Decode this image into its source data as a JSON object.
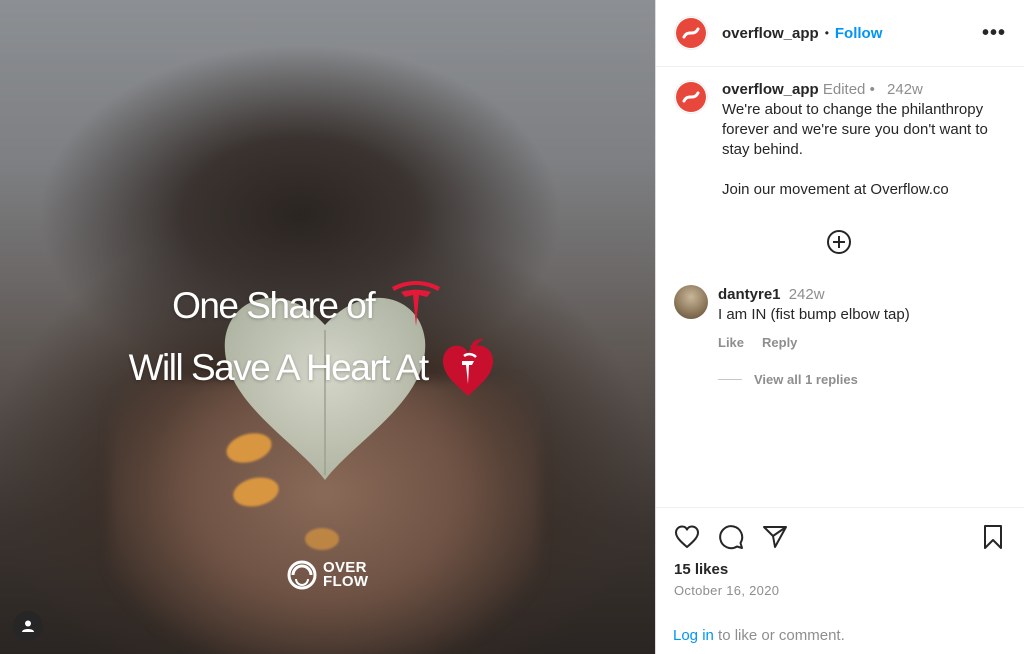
{
  "post": {
    "headline_line1": "One Share of",
    "headline_line2": "Will Save A Heart At",
    "brand_mark_top": "OVER",
    "brand_mark_bottom": "FLOW"
  },
  "header": {
    "username": "overflow_app",
    "separator": "•",
    "follow_label": "Follow",
    "more_label": "•••"
  },
  "caption": {
    "username": "overflow_app",
    "edited": "Edited",
    "separator": "•",
    "age": "242w",
    "text": "We're about to change the philanthropy forever and we're sure you don't want to stay behind.\n\nJoin our movement at Overflow.co"
  },
  "comment": {
    "username": "dantyre1",
    "age": "242w",
    "text": "I am IN (fist bump elbow tap)",
    "like_label": "Like",
    "reply_label": "Reply",
    "view_replies": "View all 1 replies"
  },
  "stats": {
    "likes": "15 likes",
    "date": "October 16, 2020"
  },
  "footer": {
    "login_link": "Log in",
    "login_suffix": " to like or comment."
  },
  "colors": {
    "accent": "#0095f6",
    "brand_red": "#e8483b",
    "tesla_red": "#e31937"
  },
  "icons": [
    "heart-icon",
    "comment-icon",
    "share-icon",
    "bookmark-icon",
    "add-circle-icon",
    "user-tag-icon",
    "tesla-logo",
    "aha-logo",
    "overflow-logo"
  ]
}
